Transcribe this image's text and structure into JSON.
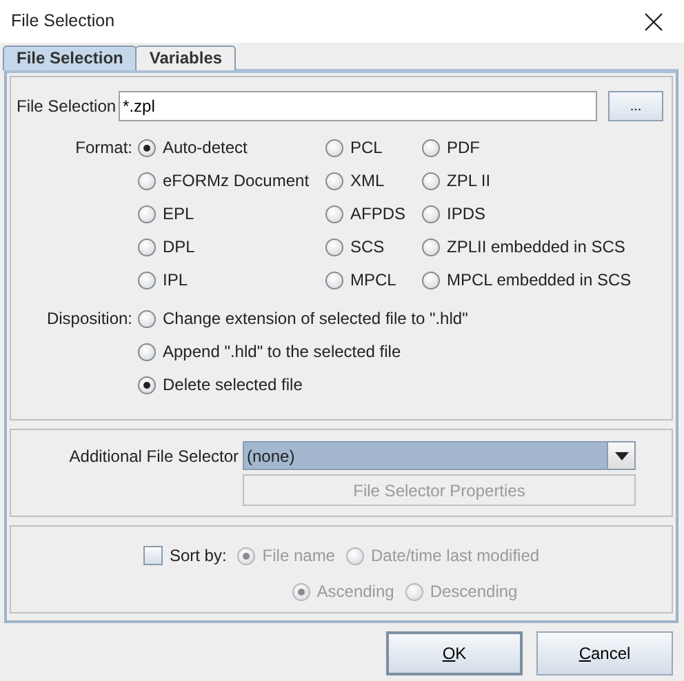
{
  "window": {
    "title": "File Selection"
  },
  "tabs": [
    {
      "label": "File Selection",
      "selected": true
    },
    {
      "label": "Variables",
      "selected": false
    }
  ],
  "file_selection": {
    "label": "File Selection",
    "value": "*.zpl",
    "browse_button": "..."
  },
  "format": {
    "label": "Format:",
    "options": [
      {
        "label": "Auto-detect",
        "selected": true
      },
      {
        "label": "PCL",
        "selected": false
      },
      {
        "label": "PDF",
        "selected": false
      },
      {
        "label": "eFORMz Document",
        "selected": false
      },
      {
        "label": "XML",
        "selected": false
      },
      {
        "label": "ZPL II",
        "selected": false
      },
      {
        "label": "EPL",
        "selected": false
      },
      {
        "label": "AFPDS",
        "selected": false
      },
      {
        "label": "IPDS",
        "selected": false
      },
      {
        "label": "DPL",
        "selected": false
      },
      {
        "label": "SCS",
        "selected": false
      },
      {
        "label": "ZPLII embedded in SCS",
        "selected": false
      },
      {
        "label": "IPL",
        "selected": false
      },
      {
        "label": "MPCL",
        "selected": false
      },
      {
        "label": "MPCL embedded in SCS",
        "selected": false
      }
    ]
  },
  "disposition": {
    "label": "Disposition:",
    "options": [
      {
        "label": "Change extension of selected file to \".hld\"",
        "selected": false
      },
      {
        "label": "Append \".hld\" to the selected file",
        "selected": false
      },
      {
        "label": "Delete selected file",
        "selected": true
      }
    ]
  },
  "additional_file_selector": {
    "label": "Additional File Selector",
    "value": "(none)",
    "properties_button": {
      "label": "File Selector Properties",
      "disabled": true
    }
  },
  "sort": {
    "label": "Sort by:",
    "checked": false,
    "fields": [
      {
        "label": "File name",
        "selected": true,
        "disabled": true
      },
      {
        "label": "Date/time last modified",
        "selected": false,
        "disabled": true
      }
    ],
    "order": [
      {
        "label": "Ascending",
        "selected": true,
        "disabled": true
      },
      {
        "label": "Descending",
        "selected": false,
        "disabled": true
      }
    ]
  },
  "buttons": [
    {
      "label": "OK",
      "mnemonic": true,
      "default": true
    },
    {
      "label": "Cancel",
      "mnemonic": true,
      "default": false
    }
  ]
}
